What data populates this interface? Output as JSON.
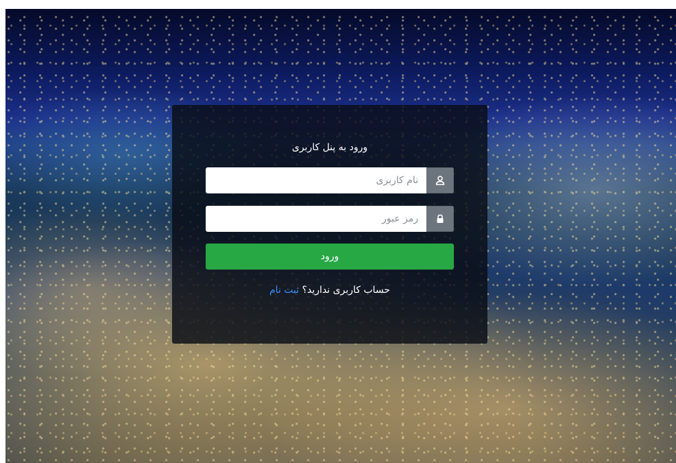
{
  "login": {
    "title": "ورود به پنل کاربری",
    "username_placeholder": "نام کاربری",
    "password_placeholder": "رمز عبور",
    "submit_label": "ورود",
    "register_prompt": "حساب کاربری ندارید؟",
    "register_link": "ثبت نام"
  },
  "icons": {
    "username": "user-icon",
    "password": "lock-icon"
  },
  "colors": {
    "submit": "#28a745",
    "addon": "#6c757d",
    "link": "#3b8cff"
  }
}
